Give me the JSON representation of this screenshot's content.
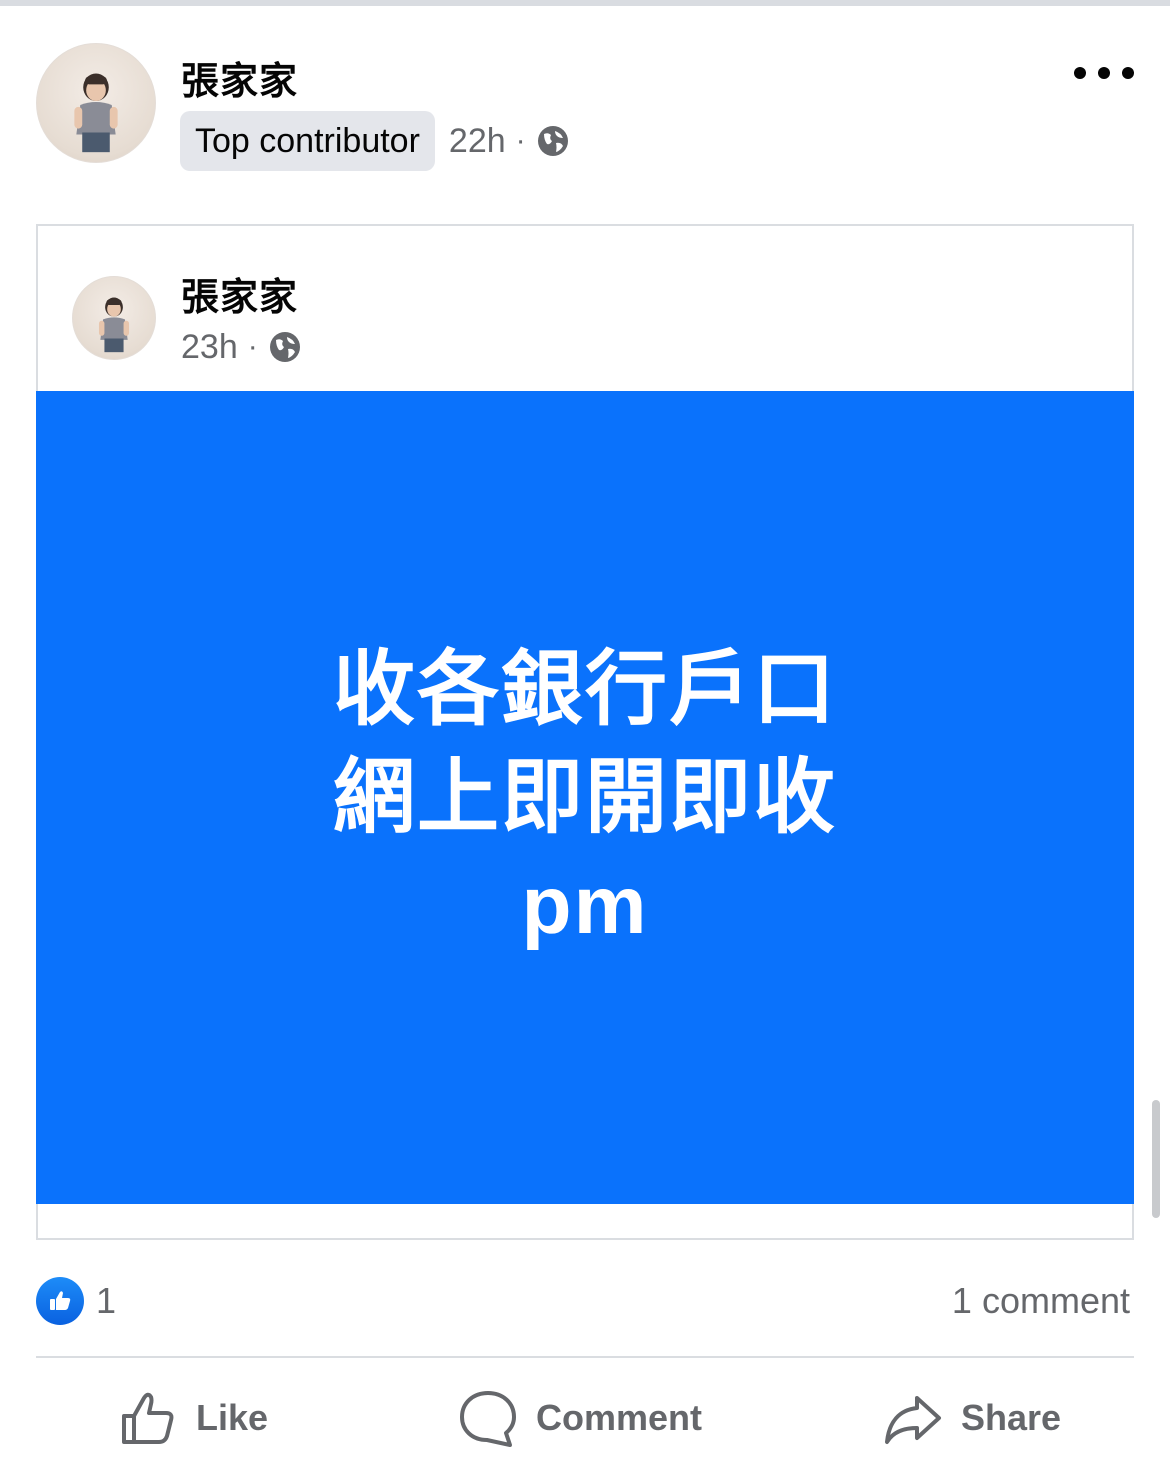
{
  "post": {
    "author": "張家家",
    "badge": "Top contributor",
    "time": "22h",
    "separator": "·",
    "privacy_icon": "globe-icon",
    "more_icon": "more-dots-icon"
  },
  "shared_post": {
    "author": "張家家",
    "time": "23h",
    "separator": "·",
    "privacy_icon": "globe-icon",
    "background_color": "#0a72fc",
    "text_lines": [
      "收各銀行戶口",
      "網上即開即收",
      "pm"
    ]
  },
  "reactions": {
    "icon": "like-reaction-icon",
    "count": "1",
    "comments": "1 comment"
  },
  "actions": {
    "like_label": "Like",
    "comment_label": "Comment",
    "share_label": "Share"
  },
  "colors": {
    "accent": "#0a72fc",
    "secondary_text": "#65676b",
    "badge_bg": "#e4e6eb"
  }
}
